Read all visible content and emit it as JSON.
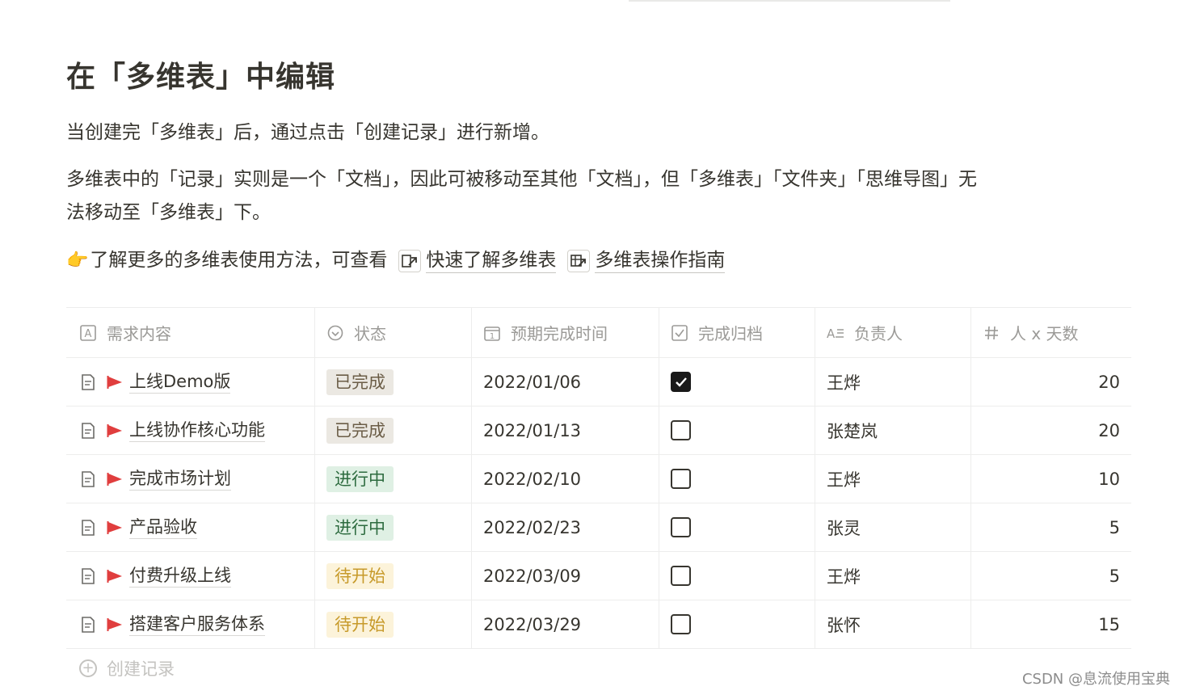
{
  "page": {
    "title": "在「多维表」中编辑",
    "para1": "当创建完「多维表」后，通过点击「创建记录」进行新增。",
    "para2_line1": "多维表中的「记录」实则是一个「文档」，因此可被移动至其他「文档」，但「多维表」「文件夹」「思维导图」无",
    "para2_line2": "法移动至「多维表」下。",
    "para3_prefix": "了解更多的多维表使用方法，可查看",
    "link1": "快速了解多维表",
    "link2": "多维表操作指南"
  },
  "table": {
    "headers": [
      "需求内容",
      "状态",
      "预期完成时间",
      "完成归档",
      "负责人",
      "人 x 天数"
    ],
    "rows": [
      {
        "title": "上线Demo版",
        "status": "已完成",
        "date": "2022/01/06",
        "done": true,
        "owner": "王烨",
        "days": "20"
      },
      {
        "title": "上线协作核心功能",
        "status": "已完成",
        "date": "2022/01/13",
        "done": false,
        "owner": "张楚岚",
        "days": "20"
      },
      {
        "title": "完成市场计划",
        "status": "进行中",
        "date": "2022/02/10",
        "done": false,
        "owner": "王烨",
        "days": "10"
      },
      {
        "title": "产品验收",
        "status": "进行中",
        "date": "2022/02/23",
        "done": false,
        "owner": "张灵",
        "days": "5"
      },
      {
        "title": "付费升级上线",
        "status": "待开始",
        "date": "2022/03/09",
        "done": false,
        "owner": "王烨",
        "days": "5"
      },
      {
        "title": "搭建客户服务体系",
        "status": "待开始",
        "date": "2022/03/29",
        "done": false,
        "owner": "张怀",
        "days": "15"
      }
    ],
    "add_record": "创建记录"
  },
  "status_colors": {
    "已完成": {
      "bg": "#ebe8e2",
      "fg": "#6b5d47"
    },
    "进行中": {
      "bg": "#dff0e4",
      "fg": "#2d6b3f"
    },
    "待开始": {
      "bg": "#fcf3da",
      "fg": "#c79a2a"
    }
  },
  "flag_color": "#e03e3e",
  "watermark": "CSDN @息流使用宝典"
}
